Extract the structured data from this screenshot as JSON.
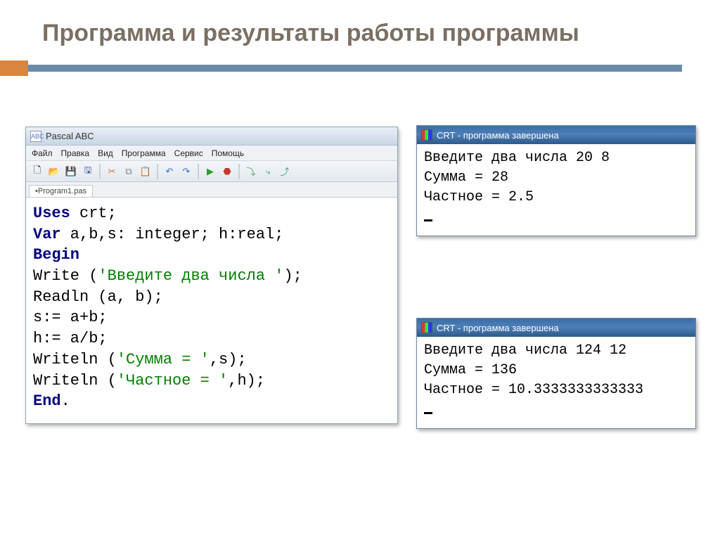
{
  "slide_title": "Программа и результаты работы программы",
  "ide": {
    "app_icon_text": "ABC",
    "title": "Pascal ABC",
    "menus": [
      "Файл",
      "Правка",
      "Вид",
      "Программа",
      "Сервис",
      "Помощь"
    ],
    "tab_label": "•Program1.pas",
    "code": {
      "l1_kw": "Uses",
      "l1_rest": " crt;",
      "l2_kw": "Var",
      "l2_rest": " a,b,s: integer; h:real;",
      "l3_kw": "Begin",
      "l4_a": "Write (",
      "l4_str": "'Введите два числа '",
      "l4_b": ");",
      "l5": "Readln (a, b);",
      "l6": "s:= a+b;",
      "l7": "h:= a/b;",
      "l8_a": "Writeln (",
      "l8_str": "'Сумма = '",
      "l8_b": ",s);",
      "l9_a": "Writeln (",
      "l9_str": "'Частное = '",
      "l9_b": ",h);",
      "l10_kw": "End",
      "l10_rest": "."
    }
  },
  "crt1": {
    "title": "CRT - программа завершена",
    "body": "Введите два числа 20 8\nСумма = 28\nЧастное = 2.5"
  },
  "crt2": {
    "title": "CRT - программа завершена",
    "body": "Введите два числа 124 12\nСумма = 136\nЧастное = 10.3333333333333"
  },
  "toolbar_icons": {
    "new": "🗋",
    "open": "📂",
    "save": "💾",
    "saveall": "🖫",
    "cut": "✂",
    "copy": "⧉",
    "paste": "📋",
    "undo": "↶",
    "redo": "↷",
    "run": "▶",
    "stop": "⬣",
    "stepover": "⤵",
    "stepin": "⤷",
    "stepout": "⤴"
  }
}
